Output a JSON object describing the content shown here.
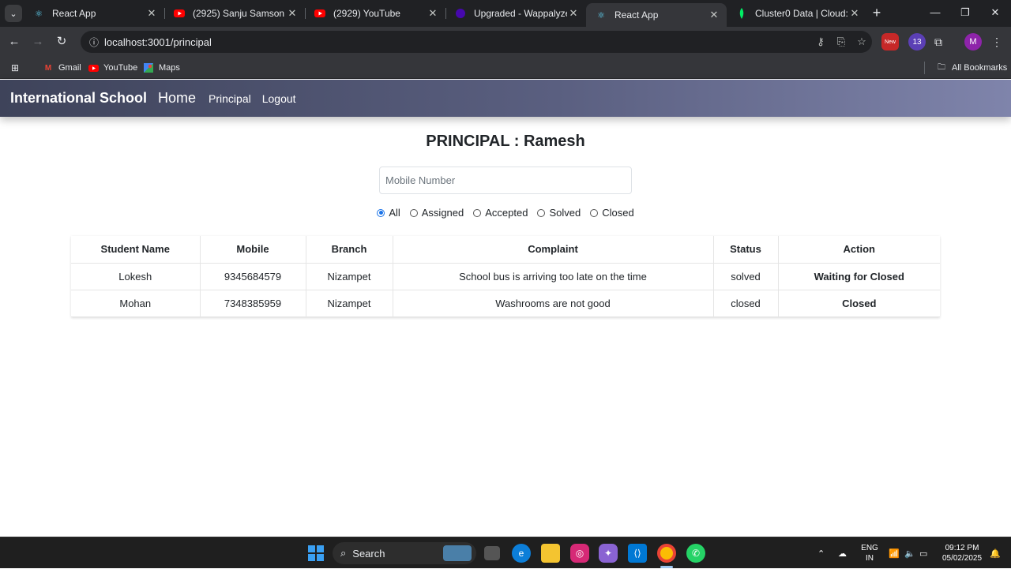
{
  "browser": {
    "tabs": [
      {
        "title": "React App",
        "favicon": "react-icon",
        "active": false
      },
      {
        "title": "(2925) Sanju Samson & Su",
        "favicon": "youtube-icon",
        "active": false
      },
      {
        "title": "(2929) YouTube",
        "favicon": "youtube-icon",
        "active": false
      },
      {
        "title": "Upgraded - Wappalyzer",
        "favicon": "wappalyzer-icon",
        "active": false
      },
      {
        "title": "React App",
        "favicon": "react-icon",
        "active": true
      },
      {
        "title": "Cluster0 Data | Cloud: Mo",
        "favicon": "mongodb-leaf-icon",
        "active": false
      }
    ],
    "url": "localhost:3001/principal",
    "extension_badges": {
      "new": "New",
      "count": "13"
    },
    "profile_initial": "M",
    "bookmarks": [
      {
        "label": "Gmail",
        "icon": "gmail-icon"
      },
      {
        "label": "YouTube",
        "icon": "youtube-icon"
      },
      {
        "label": "Maps",
        "icon": "maps-icon"
      }
    ],
    "all_bookmarks": "All Bookmarks"
  },
  "navbar": {
    "brand": "International School",
    "home": "Home",
    "links": [
      "Principal",
      "Logout"
    ]
  },
  "page": {
    "heading": "PRINCIPAL : Ramesh",
    "search_placeholder": "Mobile Number",
    "search_value": "",
    "filters": [
      {
        "label": "All",
        "checked": true
      },
      {
        "label": "Assigned",
        "checked": false
      },
      {
        "label": "Accepted",
        "checked": false
      },
      {
        "label": "Solved",
        "checked": false
      },
      {
        "label": "Closed",
        "checked": false
      }
    ]
  },
  "table": {
    "headers": [
      "Student Name",
      "Mobile",
      "Branch",
      "Complaint",
      "Status",
      "Action"
    ],
    "rows": [
      [
        "Lokesh",
        "9345684579",
        "Nizampet",
        "School bus is arriving too late on the time",
        "solved",
        "Waiting for Closed"
      ],
      [
        "Mohan",
        "7348385959",
        "Nizampet",
        "Washrooms are not good",
        "closed",
        "Closed"
      ]
    ]
  },
  "taskbar": {
    "search_label": "Search",
    "lang": [
      "ENG",
      "IN"
    ],
    "time": "09:12 PM",
    "date": "05/02/2025"
  },
  "colors": {
    "accent": "#1a73e8",
    "navbar_start": "#3e435a",
    "navbar_end": "#7f84ab"
  }
}
